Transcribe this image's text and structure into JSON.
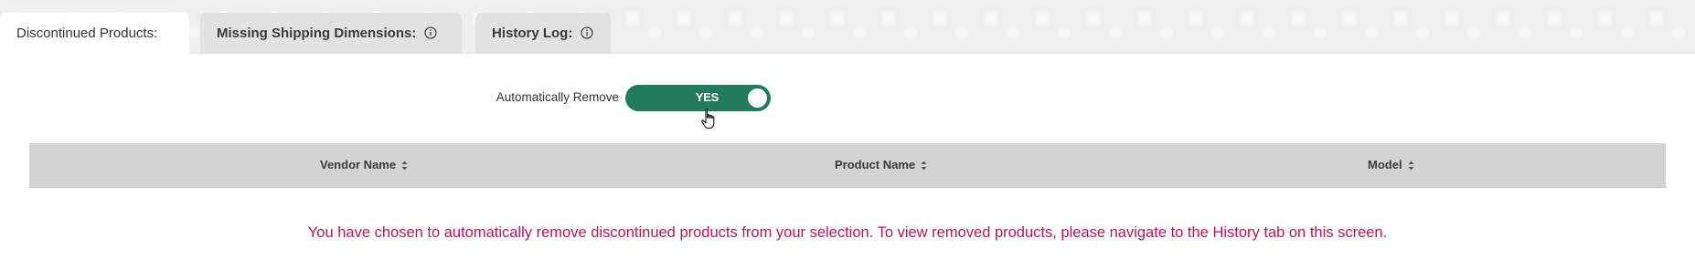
{
  "tabs": [
    {
      "label": "Discontinued Products:",
      "active": true,
      "has_info_icon": false
    },
    {
      "label": "Missing Shipping Dimensions:",
      "active": false,
      "has_info_icon": true
    },
    {
      "label": "History Log:",
      "active": false,
      "has_info_icon": true
    }
  ],
  "auto_remove": {
    "label": "Automatically Remove",
    "toggle_text": "YES",
    "enabled": true,
    "on_color": "#217a5e"
  },
  "table": {
    "columns": [
      "Vendor Name",
      "Product Name",
      "Model"
    ],
    "sort_icon": "sort-updown-icon",
    "rows": []
  },
  "message": {
    "text": "You have chosen to automatically remove discontinued products from your selection. To view removed products, please navigate to the History tab on this screen.",
    "color": "#b5175b"
  },
  "icons": {
    "info": "info-circle-icon",
    "cursor": "hand-pointer-icon"
  }
}
